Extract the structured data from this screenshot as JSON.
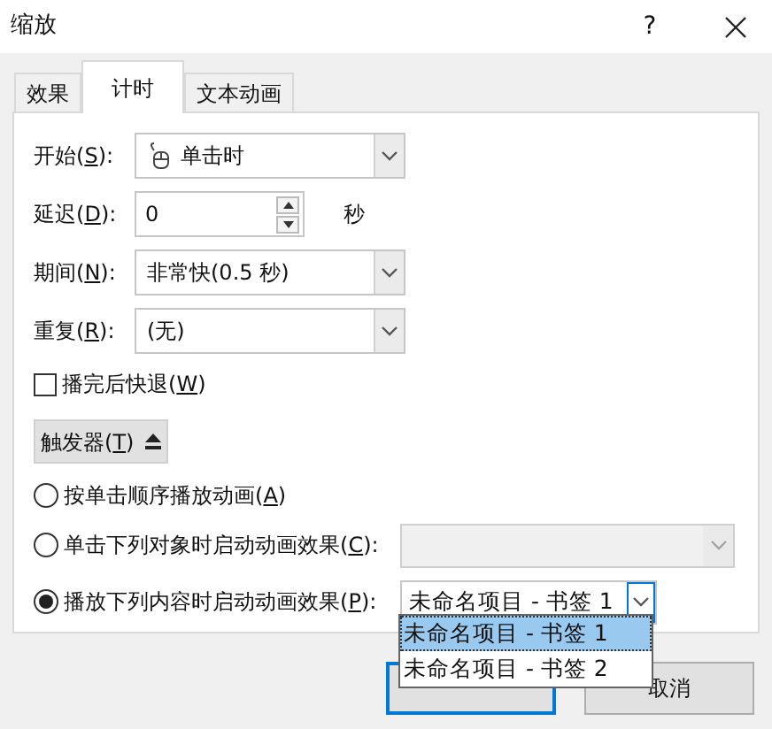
{
  "window": {
    "title": "缩放",
    "help": "?"
  },
  "tabs": [
    {
      "label": "效果",
      "selected": false
    },
    {
      "label": "计时",
      "selected": true
    },
    {
      "label": "文本动画",
      "selected": false
    }
  ],
  "fields": [
    {
      "kind": "dropdown",
      "label": {
        "before": "开始(",
        "key": "S",
        "after": "):"
      },
      "value": "单击时"
    },
    {
      "kind": "spinner",
      "label": {
        "before": "延迟(",
        "key": "D",
        "after": "):"
      },
      "value": "0",
      "unit": "秒"
    },
    {
      "kind": "dropdown",
      "label": {
        "before": "期间(",
        "key": "N",
        "after": "):"
      },
      "value": "非常快(0.5 秒)"
    },
    {
      "kind": "dropdown",
      "label": {
        "before": "重复(",
        "key": "R",
        "after": "):"
      },
      "value": "(无)"
    }
  ],
  "rewind": {
    "label": {
      "before": "播完后快退(",
      "key": "W",
      "after": ")"
    },
    "checked": false
  },
  "triggers_button": {
    "label": {
      "before": "触发器(",
      "key": "T",
      "after": ")"
    },
    "expanded": true
  },
  "trigger_options": [
    {
      "label": {
        "before": "按单击顺序播放动画(",
        "key": "A",
        "after": ")"
      },
      "selected": false
    },
    {
      "label": {
        "before": "单击下列对象时启动动画效果(",
        "key": "C",
        "after": "):"
      },
      "selected": false,
      "combo": {
        "disabled": true
      }
    },
    {
      "label": {
        "before": "播放下列内容时启动动画效果(",
        "key": "P",
        "after": "):"
      },
      "selected": true,
      "combo": {
        "value": "未命名项目 - 书签 1",
        "disabled": false,
        "open": true,
        "options": [
          {
            "label": "未命名项目 - 书签 1",
            "selected": true
          },
          {
            "label": "未命名项目 - 书签 2",
            "selected": false
          }
        ]
      }
    }
  ],
  "buttons": [
    {
      "default": true
    },
    {
      "label": "取消",
      "default": false
    }
  ]
}
